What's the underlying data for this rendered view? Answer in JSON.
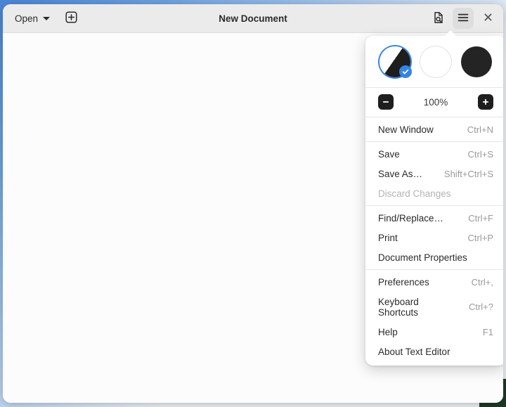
{
  "window": {
    "title": "New Document"
  },
  "headerbar": {
    "open_label": "Open",
    "open_caret_icon": "chevron-down-icon",
    "new_tab_icon": "plus-square-icon",
    "find_icon": "document-find-icon",
    "menu_icon": "hamburger-menu-icon",
    "close_icon": "close-icon"
  },
  "menu": {
    "theme": {
      "options": [
        {
          "name": "system",
          "label": "Follow system style",
          "selected": true
        },
        {
          "name": "light",
          "label": "Light style",
          "selected": false
        },
        {
          "name": "dark",
          "label": "Dark style",
          "selected": false
        }
      ],
      "check_icon": "check-icon"
    },
    "zoom": {
      "out_icon": "minus-icon",
      "in_icon": "plus-icon",
      "level": "100%"
    },
    "groups": [
      {
        "items": [
          {
            "label": "New Window",
            "accel": "Ctrl+N",
            "disabled": false
          }
        ]
      },
      {
        "items": [
          {
            "label": "Save",
            "accel": "Ctrl+S",
            "disabled": false
          },
          {
            "label": "Save As…",
            "accel": "Shift+Ctrl+S",
            "disabled": false
          },
          {
            "label": "Discard Changes",
            "accel": "",
            "disabled": true
          }
        ]
      },
      {
        "items": [
          {
            "label": "Find/Replace…",
            "accel": "Ctrl+F",
            "disabled": false
          },
          {
            "label": "Print",
            "accel": "Ctrl+P",
            "disabled": false
          },
          {
            "label": "Document Properties",
            "accel": "",
            "disabled": false
          }
        ]
      },
      {
        "items": [
          {
            "label": "Preferences",
            "accel": "Ctrl+,",
            "disabled": false
          },
          {
            "label": "Keyboard Shortcuts",
            "accel": "Ctrl+?",
            "disabled": false
          },
          {
            "label": "Help",
            "accel": "F1",
            "disabled": false
          },
          {
            "label": "About Text Editor",
            "accel": "",
            "disabled": false
          }
        ]
      }
    ]
  },
  "document": {
    "content": ""
  },
  "colors": {
    "accent": "#3584e4",
    "headerbar_bg": "#ebebeb",
    "document_bg": "#fcfcfc",
    "menu_bg": "#ffffff",
    "dark_swatch": "#242424",
    "desktop_green": "#1d3a24"
  }
}
